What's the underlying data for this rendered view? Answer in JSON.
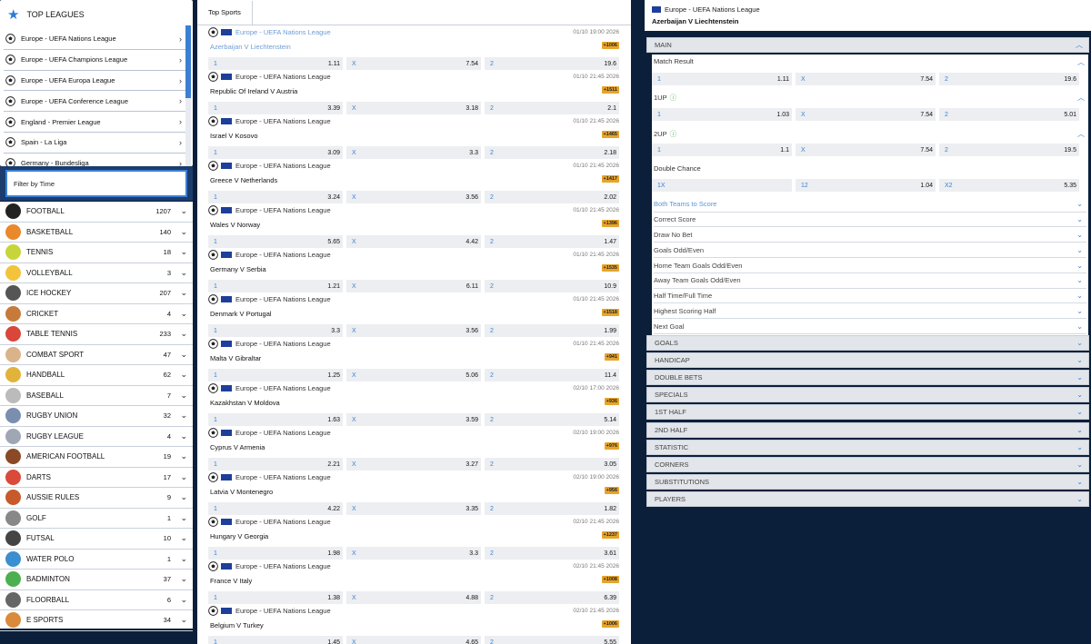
{
  "top_leagues": {
    "title": "TOP LEAGUES",
    "items": [
      "Europe - UEFA Nations League",
      "Europe - UEFA Champions League",
      "Europe - UEFA Europa League",
      "Europe - UEFA Conference League",
      "England - Premier League",
      "Spain - La Liga",
      "Germany - Bundesliga"
    ]
  },
  "filter": {
    "label": "Filter by Time"
  },
  "sports": [
    {
      "name": "FOOTBALL",
      "count": "1207",
      "color": "#222"
    },
    {
      "name": "BASKETBALL",
      "count": "140",
      "color": "#e8892b"
    },
    {
      "name": "TENNIS",
      "count": "18",
      "color": "#c6d63a"
    },
    {
      "name": "VOLLEYBALL",
      "count": "3",
      "color": "#f3c43b"
    },
    {
      "name": "ICE HOCKEY",
      "count": "207",
      "color": "#555"
    },
    {
      "name": "CRICKET",
      "count": "4",
      "color": "#c77b3a"
    },
    {
      "name": "TABLE TENNIS",
      "count": "233",
      "color": "#d9473a"
    },
    {
      "name": "COMBAT SPORT",
      "count": "47",
      "color": "#d9b48a"
    },
    {
      "name": "HANDBALL",
      "count": "62",
      "color": "#e2b33a"
    },
    {
      "name": "BASEBALL",
      "count": "7",
      "color": "#bbb"
    },
    {
      "name": "RUGBY UNION",
      "count": "32",
      "color": "#7a8fb0"
    },
    {
      "name": "RUGBY LEAGUE",
      "count": "4",
      "color": "#a0a7b4"
    },
    {
      "name": "AMERICAN FOOTBALL",
      "count": "19",
      "color": "#8a4a26"
    },
    {
      "name": "DARTS",
      "count": "17",
      "color": "#d94a3a"
    },
    {
      "name": "AUSSIE RULES",
      "count": "9",
      "color": "#c65a2a"
    },
    {
      "name": "GOLF",
      "count": "1",
      "color": "#888"
    },
    {
      "name": "FUTSAL",
      "count": "10",
      "color": "#444"
    },
    {
      "name": "WATER POLO",
      "count": "1",
      "color": "#3a8fd0"
    },
    {
      "name": "BADMINTON",
      "count": "37",
      "color": "#4caf50"
    },
    {
      "name": "FLOORBALL",
      "count": "6",
      "color": "#666"
    },
    {
      "name": "E SPORTS",
      "count": "34",
      "color": "#d98a3a"
    }
  ],
  "middle": {
    "tab": "Top Sports",
    "matches": [
      {
        "league": "Europe - UEFA Nations League",
        "date": "01/10 19:00 2026",
        "teams": "Azerbaijan V Liechtenstein",
        "more": "+1006",
        "o1": "1.11",
        "ox": "7.54",
        "o2": "19.6"
      },
      {
        "league": "Europe - UEFA Nations League",
        "date": "01/10 21:45 2026",
        "teams": "Republic Of Ireland V Austria",
        "more": "+1511",
        "o1": "3.39",
        "ox": "3.18",
        "o2": "2.1"
      },
      {
        "league": "Europe - UEFA Nations League",
        "date": "01/10 21:45 2026",
        "teams": "Israel V Kosovo",
        "more": "+1465",
        "o1": "3.09",
        "ox": "3.3",
        "o2": "2.18"
      },
      {
        "league": "Europe - UEFA Nations League",
        "date": "01/10 21:45 2026",
        "teams": "Greece V Netherlands",
        "more": "+1417",
        "o1": "3.24",
        "ox": "3.56",
        "o2": "2.02"
      },
      {
        "league": "Europe - UEFA Nations League",
        "date": "01/10 21:45 2026",
        "teams": "Wales V Norway",
        "more": "+1396",
        "o1": "5.65",
        "ox": "4.42",
        "o2": "1.47"
      },
      {
        "league": "Europe - UEFA Nations League",
        "date": "01/10 21:45 2026",
        "teams": "Germany V Serbia",
        "more": "+1535",
        "o1": "1.21",
        "ox": "6.11",
        "o2": "10.9"
      },
      {
        "league": "Europe - UEFA Nations League",
        "date": "01/10 21:45 2026",
        "teams": "Denmark V Portugal",
        "more": "+1518",
        "o1": "3.3",
        "ox": "3.56",
        "o2": "1.99"
      },
      {
        "league": "Europe - UEFA Nations League",
        "date": "01/10 21:45 2026",
        "teams": "Malta V Gibraltar",
        "more": "+941",
        "o1": "1.25",
        "ox": "5.06",
        "o2": "11.4"
      },
      {
        "league": "Europe - UEFA Nations League",
        "date": "02/10 17:00 2026",
        "teams": "Kazakhstan V Moldova",
        "more": "+936",
        "o1": "1.63",
        "ox": "3.59",
        "o2": "5.14"
      },
      {
        "league": "Europe - UEFA Nations League",
        "date": "02/10 19:00 2026",
        "teams": "Cyprus V Armenia",
        "more": "+976",
        "o1": "2.21",
        "ox": "3.27",
        "o2": "3.05"
      },
      {
        "league": "Europe - UEFA Nations League",
        "date": "02/10 19:00 2026",
        "teams": "Latvia V Montenegro",
        "more": "+956",
        "o1": "4.22",
        "ox": "3.35",
        "o2": "1.82"
      },
      {
        "league": "Europe - UEFA Nations League",
        "date": "02/10 21:45 2026",
        "teams": "Hungary V Georgia",
        "more": "+1237",
        "o1": "1.98",
        "ox": "3.3",
        "o2": "3.61"
      },
      {
        "league": "Europe - UEFA Nations League",
        "date": "02/10 21:45 2026",
        "teams": "France V Italy",
        "more": "+1008",
        "o1": "1.38",
        "ox": "4.88",
        "o2": "6.39"
      },
      {
        "league": "Europe - UEFA Nations League",
        "date": "02/10 21:45 2026",
        "teams": "Belgium V Turkey",
        "more": "+1006",
        "o1": "1.45",
        "ox": "4.65",
        "o2": "5.55"
      }
    ]
  },
  "detail": {
    "league": "Europe - UEFA Nations League",
    "teams": "Azerbaijan V Liechtenstein",
    "main_label": "MAIN",
    "match_result": {
      "label": "Match Result",
      "o1": "1.11",
      "ox": "7.54",
      "o2": "19.6"
    },
    "one_up": {
      "label": "1UP",
      "o1": "1.03",
      "ox": "7.54",
      "o2": "5.01"
    },
    "two_up": {
      "label": "2UP",
      "o1": "1.1",
      "ox": "7.54",
      "o2": "19.5"
    },
    "double_chance": {
      "label": "Double Chance",
      "l1": "1X",
      "v1": "",
      "l2": "12",
      "v2": "1.04",
      "l3": "X2",
      "v3": "5.35"
    },
    "markets": [
      "Both Teams to Score",
      "Correct Score",
      "Draw No Bet",
      "Goals Odd/Even",
      "Home Team Goals Odd/Even",
      "Away Team Goals Odd/Even",
      "Half Time/Full Time",
      "Highest Scoring Half",
      "Next Goal"
    ],
    "sections": [
      "GOALS",
      "HANDICAP",
      "DOUBLE BETS",
      "SPECIALS",
      "1ST HALF",
      "2ND HALF",
      "STATISTIC",
      "CORNERS",
      "SUBSTITUTIONS",
      "PLAYERS"
    ]
  },
  "labels": {
    "one": "1",
    "x": "X",
    "two": "2"
  }
}
